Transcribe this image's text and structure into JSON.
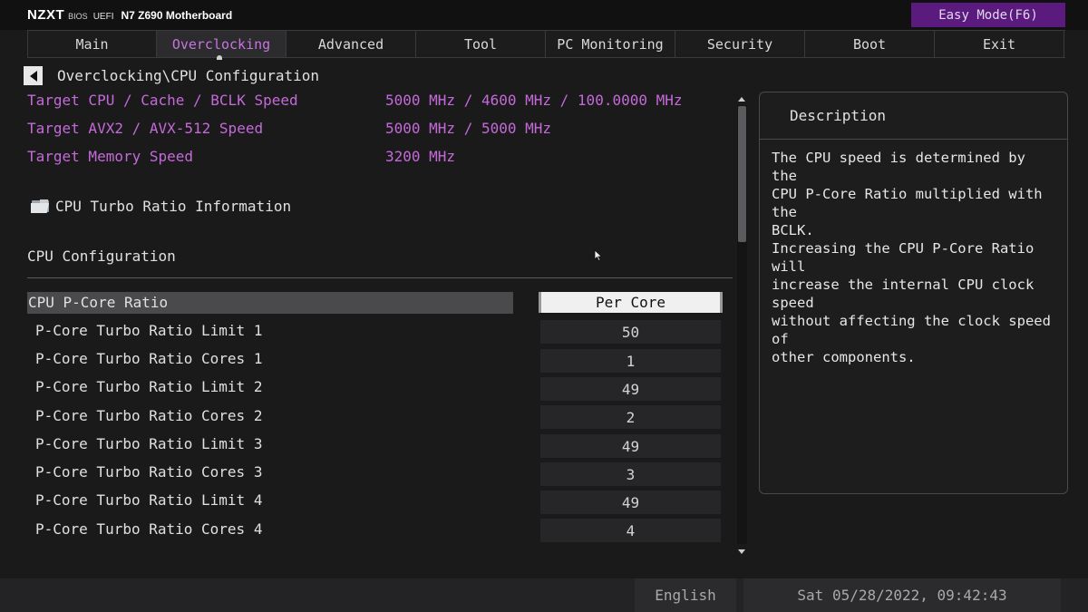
{
  "header": {
    "brand_logo": "NZXT",
    "brand_bios": "BIOS",
    "brand_uefi": "UEFI",
    "brand_model": "N7 Z690 Motherboard",
    "easy_mode": "Easy Mode(F6)"
  },
  "tabs": [
    {
      "label": "Main"
    },
    {
      "label": "Overclocking",
      "active": true
    },
    {
      "label": "Advanced"
    },
    {
      "label": "Tool"
    },
    {
      "label": "PC Monitoring"
    },
    {
      "label": "Security"
    },
    {
      "label": "Boot"
    },
    {
      "label": "Exit"
    }
  ],
  "breadcrumb": "Overclocking\\CPU Configuration",
  "targets": [
    {
      "label": "Target CPU / Cache / BCLK Speed",
      "value": "5000 MHz / 4600 MHz / 100.0000 MHz"
    },
    {
      "label": "Target AVX2 / AVX-512 Speed",
      "value": "5000 MHz / 5000 MHz"
    },
    {
      "label": "Target Memory Speed",
      "value": "3200 MHz"
    }
  ],
  "submenu": "CPU Turbo Ratio Information",
  "section_title": "CPU Configuration",
  "settings": [
    {
      "label": "CPU P-Core Ratio",
      "value": "Per Core",
      "selected": true
    },
    {
      "label": "P-Core Turbo Ratio Limit 1",
      "value": "50"
    },
    {
      "label": "P-Core Turbo Ratio Cores 1",
      "value": "1"
    },
    {
      "label": "P-Core Turbo Ratio Limit 2",
      "value": "49"
    },
    {
      "label": "P-Core Turbo Ratio Cores 2",
      "value": "2"
    },
    {
      "label": "P-Core Turbo Ratio Limit 3",
      "value": "49"
    },
    {
      "label": "P-Core Turbo Ratio Cores 3",
      "value": "3"
    },
    {
      "label": "P-Core Turbo Ratio Limit 4",
      "value": "49"
    },
    {
      "label": "P-Core Turbo Ratio Cores 4",
      "value": "4"
    }
  ],
  "description": {
    "title": "Description",
    "text": "The CPU speed is determined by the\nCPU P-Core Ratio multiplied with the\nBCLK.\nIncreasing the CPU P-Core Ratio will\nincrease the internal CPU clock speed\nwithout affecting the clock speed of\nother components."
  },
  "footer": {
    "language": "English",
    "datetime": "Sat 05/28/2022, 09:42:43"
  },
  "colors": {
    "accent": "#c46ad8",
    "easy_mode_bg": "#5a1a7e"
  }
}
